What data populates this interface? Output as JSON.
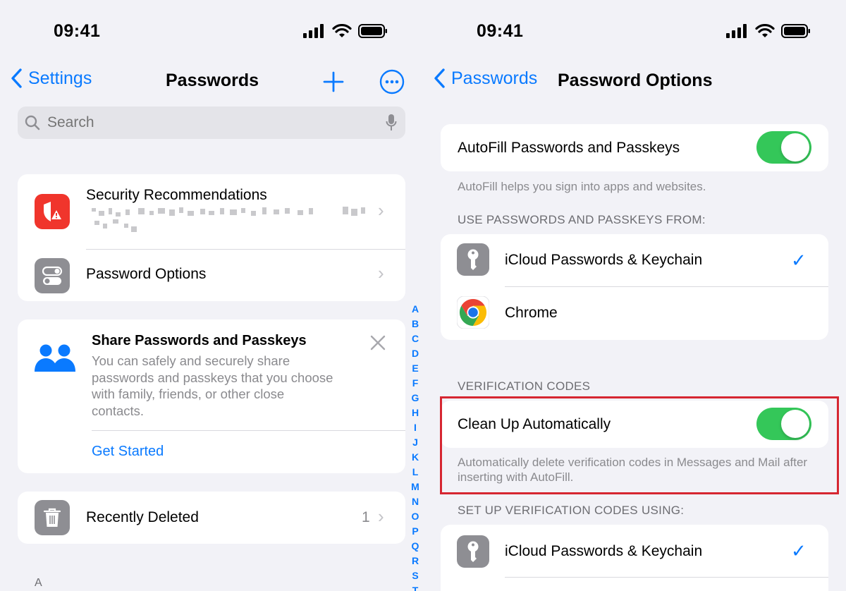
{
  "left": {
    "status_time": "09:41",
    "nav": {
      "back_label": "Settings",
      "title": "Passwords"
    },
    "search": {
      "placeholder": "Search"
    },
    "security": {
      "title": "Security Recommendations"
    },
    "password_options": {
      "label": "Password Options"
    },
    "share": {
      "title": "Share Passwords and Passkeys",
      "body": "You can safely and securely share passwords and passkeys that you choose with family, friends, or other close contacts.",
      "cta": "Get Started"
    },
    "recently_deleted": {
      "label": "Recently Deleted",
      "count": "1"
    },
    "section_letter": "A",
    "index_letters": [
      "A",
      "B",
      "C",
      "D",
      "E",
      "F",
      "G",
      "H",
      "I",
      "J",
      "K",
      "L",
      "M",
      "N",
      "O",
      "P",
      "Q",
      "R",
      "S",
      "T"
    ]
  },
  "right": {
    "status_time": "09:41",
    "nav": {
      "back_label": "Passwords",
      "title": "Password Options"
    },
    "autofill": {
      "label": "AutoFill Passwords and Passkeys",
      "enabled": true,
      "footnote": "AutoFill helps you sign into apps and websites."
    },
    "use_from": {
      "header": "USE PASSWORDS AND PASSKEYS FROM:",
      "items": [
        {
          "label": "iCloud Passwords & Keychain",
          "checked": true
        },
        {
          "label": "Chrome",
          "checked": false
        }
      ]
    },
    "verification": {
      "header": "VERIFICATION CODES",
      "clean_label": "Clean Up Automatically",
      "enabled": true,
      "footnote": "Automatically delete verification codes in Messages and Mail after inserting with AutoFill."
    },
    "setup": {
      "header": "SET UP VERIFICATION CODES USING:",
      "items": [
        {
          "label": "iCloud Passwords & Keychain",
          "checked": true
        }
      ]
    }
  },
  "colors": {
    "accent": "#0a7aff",
    "toggle_on": "#34c759",
    "security_red": "#f0352c",
    "highlight": "#d62631"
  }
}
